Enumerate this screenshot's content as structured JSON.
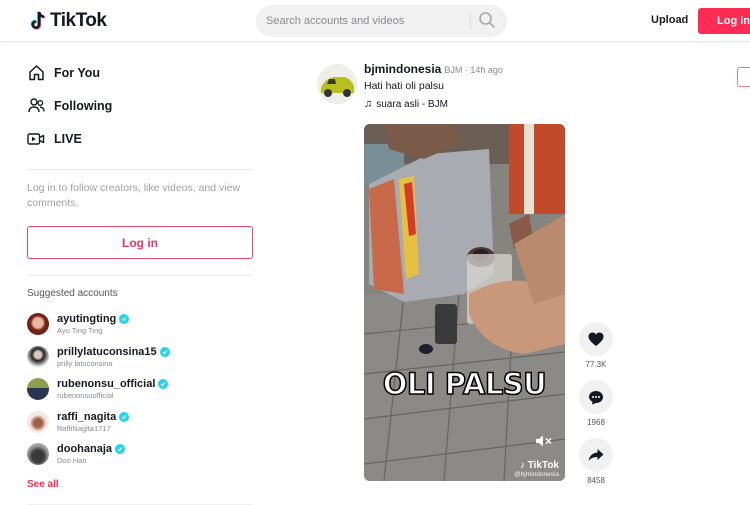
{
  "header": {
    "logo_text": "TikTok",
    "search_placeholder": "Search accounts and videos",
    "upload_label": "Upload",
    "login_label": "Log in"
  },
  "sidebar": {
    "nav": [
      {
        "label": "For You",
        "icon": "home-icon"
      },
      {
        "label": "Following",
        "icon": "users-icon"
      },
      {
        "label": "LIVE",
        "icon": "live-icon"
      }
    ],
    "login_hint": "Log in to follow creators, like videos, and view comments.",
    "login_label": "Log in",
    "suggested_title": "Suggested accounts",
    "accounts": [
      {
        "username": "ayutingting",
        "name": "Ayu Ting Ting",
        "verified": true,
        "avatar_color": "#8a3a2a"
      },
      {
        "username": "prillylatuconsina15",
        "name": "prilly latuconsina",
        "verified": true,
        "avatar_color": "#2b2b2b"
      },
      {
        "username": "rubenonsu_official",
        "name": "rubenonsuofficial",
        "verified": true,
        "avatar_color": "#4f6b3a"
      },
      {
        "username": "raffi_nagita",
        "name": "RaffiNagita1717",
        "verified": true,
        "avatar_color": "#c99a80"
      },
      {
        "username": "doohanaja",
        "name": "Doo Han",
        "verified": true,
        "avatar_color": "#6b6b6b"
      }
    ],
    "see_all_label": "See all"
  },
  "post": {
    "username": "bjmindonesia",
    "nickname": "BJM",
    "time": "14h ago",
    "caption": "Hati hati oli palsu",
    "music": "suara asli - BJM",
    "video_text": "OLI PALSU",
    "watermark_logo": "TikTok",
    "watermark_user": "@bjmindonesia",
    "actions": {
      "likes": "77.3K",
      "comments": "1968",
      "shares": "8458"
    }
  },
  "colors": {
    "brand": "#fe2c55",
    "verified": "#20d5ec",
    "text": "#161823"
  }
}
